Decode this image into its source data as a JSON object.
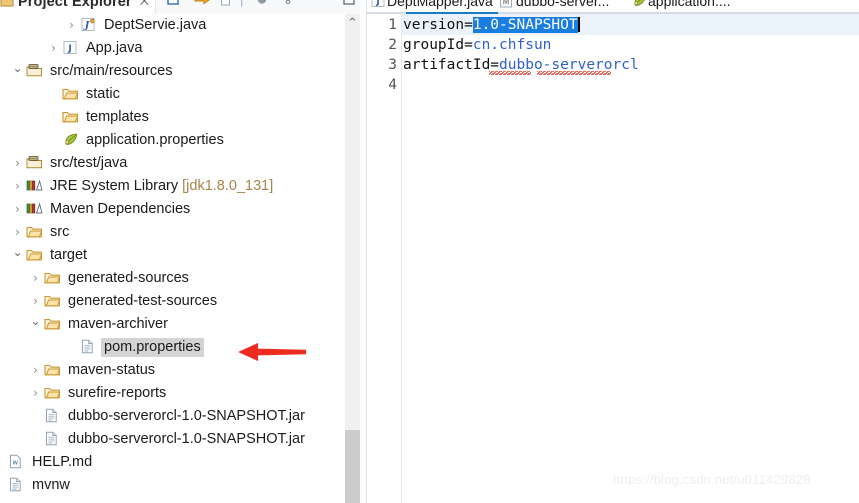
{
  "explorer": {
    "title": "Project Explorer",
    "pin_glyph": "⨉",
    "toolbar": [
      {
        "name": "collapse-all-icon",
        "glyph": "▣"
      },
      {
        "name": "link-with-editor-icon",
        "glyph": "⇨"
      },
      {
        "name": "new-file-icon",
        "glyph": "⎕"
      },
      {
        "name": "separator-icon",
        "glyph": "|"
      },
      {
        "name": "filter-icon",
        "glyph": "◕"
      },
      {
        "name": "menu-icon",
        "glyph": "⋮"
      },
      {
        "name": "maximize-icon",
        "glyph": "□"
      }
    ],
    "tree": [
      {
        "label": "DeptServie.java",
        "icon": "java-interface-icon",
        "twisty": "collapsed",
        "indent": 4,
        "selected": false
      },
      {
        "label": "App.java",
        "icon": "java-class-icon",
        "twisty": "collapsed",
        "indent": 3,
        "selected": false
      },
      {
        "label": "src/main/resources",
        "icon": "source-folder-icon",
        "twisty": "expanded",
        "indent": 1,
        "selected": false
      },
      {
        "label": "static",
        "icon": "folder-icon",
        "twisty": "none",
        "indent": 3,
        "selected": false
      },
      {
        "label": "templates",
        "icon": "folder-icon",
        "twisty": "none",
        "indent": 3,
        "selected": false
      },
      {
        "label": "application.properties",
        "icon": "properties-leaf-icon",
        "twisty": "none",
        "indent": 3,
        "selected": false
      },
      {
        "label": "src/test/java",
        "icon": "source-folder-icon",
        "twisty": "collapsed",
        "indent": 1,
        "selected": false
      },
      {
        "label": "JRE System Library",
        "icon": "library-icon",
        "twisty": "collapsed",
        "indent": 1,
        "selected": false,
        "suffix": " [jdk1.8.0_131]"
      },
      {
        "label": "Maven Dependencies",
        "icon": "library-icon",
        "twisty": "collapsed",
        "indent": 1,
        "selected": false
      },
      {
        "label": "src",
        "icon": "folder-icon",
        "twisty": "collapsed",
        "indent": 1,
        "selected": false
      },
      {
        "label": "target",
        "icon": "folder-icon",
        "twisty": "expanded",
        "indent": 1,
        "selected": false
      },
      {
        "label": "generated-sources",
        "icon": "folder-icon",
        "twisty": "collapsed",
        "indent": 2,
        "selected": false
      },
      {
        "label": "generated-test-sources",
        "icon": "folder-icon",
        "twisty": "collapsed",
        "indent": 2,
        "selected": false
      },
      {
        "label": "maven-archiver",
        "icon": "folder-icon",
        "twisty": "expanded",
        "indent": 2,
        "selected": false
      },
      {
        "label": "pom.properties",
        "icon": "file-icon",
        "twisty": "none",
        "indent": 4,
        "selected": true
      },
      {
        "label": "maven-status",
        "icon": "folder-icon",
        "twisty": "collapsed",
        "indent": 2,
        "selected": false
      },
      {
        "label": "surefire-reports",
        "icon": "folder-icon",
        "twisty": "collapsed",
        "indent": 2,
        "selected": false
      },
      {
        "label": "dubbo-serverorcl-1.0-SNAPSHOT.jar",
        "icon": "file-icon",
        "twisty": "none",
        "indent": 2,
        "selected": false
      },
      {
        "label": "dubbo-serverorcl-1.0-SNAPSHOT.jar",
        "icon": "file-icon",
        "twisty": "none",
        "indent": 2,
        "selected": false
      },
      {
        "label": "HELP.md",
        "icon": "markdown-file-icon",
        "twisty": "none",
        "indent": 0,
        "selected": false
      },
      {
        "label": "mvnw",
        "icon": "file-icon",
        "twisty": "none",
        "indent": 0,
        "selected": false
      }
    ]
  },
  "editor": {
    "tabs": [
      {
        "label": "DeptMapper.java",
        "icon": "java-class-icon",
        "active": false
      },
      {
        "label": "dubbo-server...",
        "icon": "maven-pom-icon",
        "active": false
      },
      {
        "label": "application....",
        "icon": "properties-leaf-icon",
        "active": true
      }
    ],
    "lines": [
      {
        "num": "1",
        "key": "version=",
        "value": "1.0-SNAPSHOT",
        "selected": true,
        "current": true
      },
      {
        "num": "2",
        "key": "groupId=",
        "value": "cn.chfsun",
        "selected": false,
        "current": false
      },
      {
        "num": "3",
        "key": "artifactId=",
        "value": "dubbo-serverorcl",
        "selected": false,
        "current": false
      },
      {
        "num": "4",
        "key": "",
        "value": "",
        "selected": false,
        "current": false
      }
    ]
  },
  "annotation": {
    "arrow": "red-left-arrow"
  },
  "watermark": "https://blog.csdn.net/u011429828",
  "colors": {
    "selection_blue": "#1a7ee0",
    "current_line": "#eaf3fb",
    "tree_selection": "#d4d4d4",
    "value_blue": "#2f5fd0",
    "arrow_red": "#ee2b20",
    "library_suffix": "#a6854a"
  }
}
